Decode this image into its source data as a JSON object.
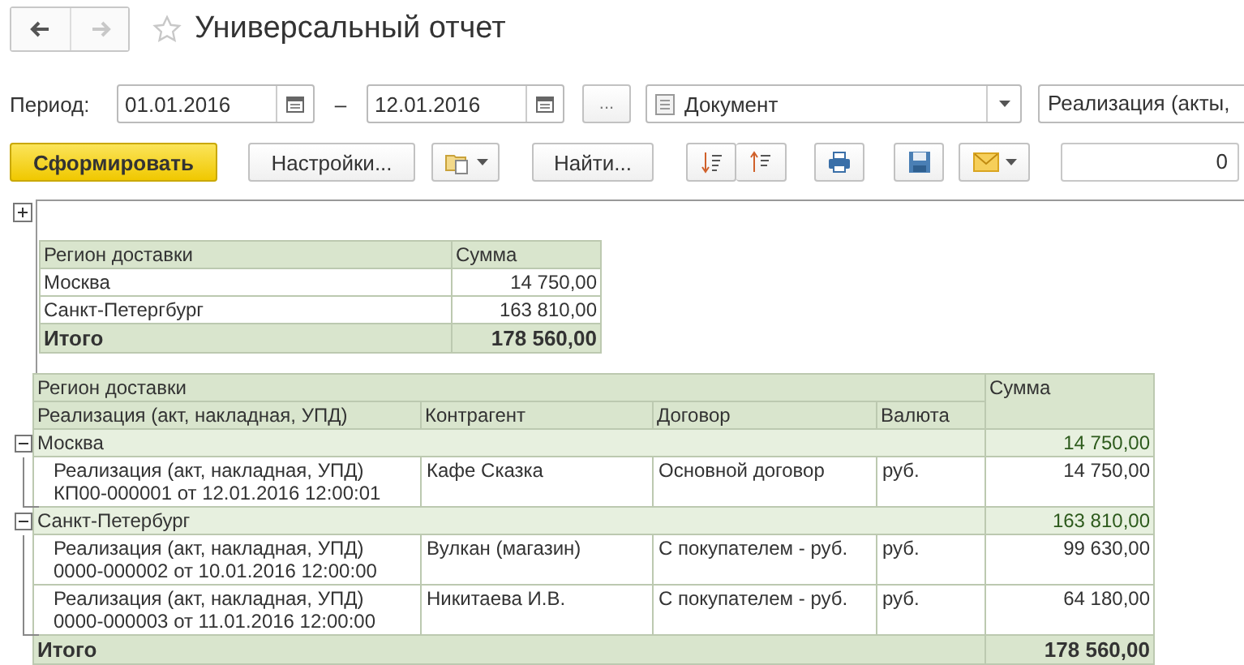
{
  "window": {
    "title": "Универсальный отчет",
    "favorite": false
  },
  "nav_buttons": [
    {
      "kind": "back",
      "disabled": false
    },
    {
      "kind": "forward",
      "disabled": true
    }
  ],
  "period": {
    "label": "Период:",
    "from": "01.01.2016",
    "separator": "–",
    "to": "12.01.2016",
    "more_button": "..."
  },
  "source": {
    "value": "Документ"
  },
  "document_type": {
    "value": "Реализация (акты,"
  },
  "toolbar": {
    "generate_button": "Сформировать",
    "settings_button": "Настройки...",
    "find_button": "Найти...",
    "counter_value": "0"
  },
  "report": {
    "expanded": false,
    "summary": {
      "columns": [
        "Регион доставки",
        "Сумма"
      ],
      "rows": [
        {
          "region": "Москва",
          "sum": "14 750,00"
        },
        {
          "region": "Санкт-Петергбург",
          "sum": "163 810,00"
        }
      ],
      "total": {
        "label": "Итого",
        "sum": "178 560,00"
      }
    },
    "detail": {
      "group_header": "Регион доставки",
      "columns": [
        "Реализация (акт, накладная, УПД)",
        "Контрагент",
        "Договор",
        "Валюта"
      ],
      "sum_column": "Сумма",
      "groups": [
        {
          "name": "Москва",
          "sum": "14 750,00",
          "expanded": true,
          "rows": [
            {
              "document": "Реализация (акт, накладная, УПД)\nКП00-000001 от 12.01.2016 12:00:01",
              "counterparty": "Кафе Сказка",
              "contract": "Основной договор",
              "currency": "руб.",
              "sum": "14 750,00"
            }
          ]
        },
        {
          "name": "Санкт-Петербург",
          "sum": "163 810,00",
          "expanded": true,
          "rows": [
            {
              "document": "Реализация (акт, накладная, УПД)\n0000-000002 от 10.01.2016 12:00:00",
              "counterparty": "Вулкан (магазин)",
              "contract": "С покупателем - руб.",
              "currency": "руб.",
              "sum": "99 630,00"
            },
            {
              "document": "Реализация (акт, накладная, УПД)\n0000-000003 от 11.01.2016 12:00:00",
              "counterparty": "Никитаева И.В.",
              "contract": "С покупателем - руб.",
              "currency": "руб.",
              "sum": "64 180,00"
            }
          ]
        }
      ],
      "total": {
        "label": "Итого",
        "sum": "178 560,00"
      }
    }
  }
}
